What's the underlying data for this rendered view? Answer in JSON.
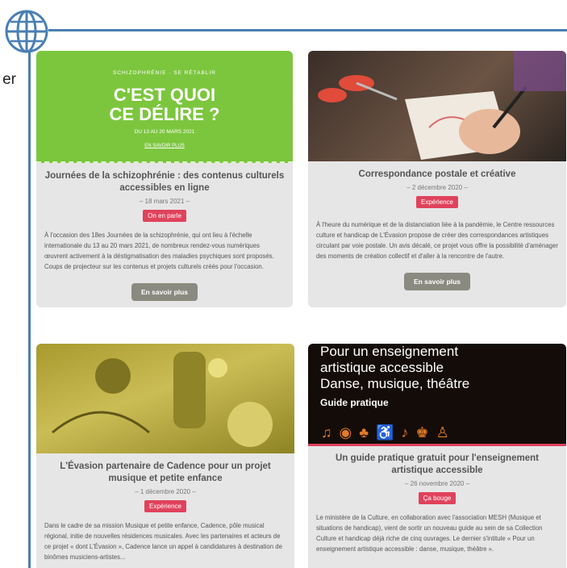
{
  "left_edge_text": "er",
  "cards": [
    {
      "hero": {
        "kicker": "SCHIZOPHRÉNIE · SE RÉTABLIR",
        "big_line1": "C'EST QUOI",
        "big_line2": "CE DÉLIRE ?",
        "dates": "DU 13 AU 20 MARS 2021",
        "link": "EN SAVOIR PLUS"
      },
      "title": "Journées de la schizophrénie : des contenus culturels accessibles en ligne",
      "date": "– 18 mars 2021 –",
      "badge": "On en parle",
      "body": "À l'occasion des 18es Journées de la schizophrénie, qui ont lieu à l'échelle internationale du 13 au 20 mars 2021, de nombreux rendez-vous numériques œuvrent activement à la déstigmatisation des maladies psychiques sont proposés. Coups de projecteur sur les contenus et projets culturels créés pour l'occasion.",
      "button": "En savoir plus"
    },
    {
      "title": "Correspondance postale et créative",
      "date": "– 2 décembre 2020 –",
      "badge": "Expérience",
      "body": "À l'heure du numérique et de la distanciation liée à la pandémie, le Centre ressources culture et handicap de L'Évasion propose de créer des correspondances artistiques circulant par voie postale. Un avis décalé, ce projet vous offre la possibilité d'aménager des moments de création collectif et d'aller à la rencontre de l'autre.",
      "button": "En savoir plus"
    },
    {
      "title": "L'Évasion partenaire de Cadence pour un projet musique et petite enfance",
      "date": "– 1 décembre 2020 –",
      "badge": "Expérience",
      "body": "Dans le cadre de sa mission Musique et petite enfance, Cadence, pôle musical régional, initie de nouvelles résidences musicales. Avec les partenaires et acteurs de ce projet « dont L'Évasion », Cadence lance un appel à candidatures à destination de binômes musiciens-artistes..."
    },
    {
      "hero": {
        "line1": "Pour un enseignement",
        "line2": "artistique accessible",
        "line3": "Danse, musique, théâtre",
        "subtitle": "Guide pratique",
        "icons": "♫◉♣♿♪♚♙"
      },
      "title": "Un guide pratique gratuit pour l'enseignement artistique accessible",
      "date": "– 26 novembre 2020 –",
      "badge": "Ça bouge",
      "body": "Le ministère de la Culture, en collaboration avec l'association MESH (Musique et situations de handicap), vient de sortir un nouveau guide au sein de sa Collection Culture et handicap déjà riche de cinq ouvrages. Le dernier s'intitule « Pour un enseignement artistique accessible : danse, musique, théâtre »."
    }
  ],
  "colors": {
    "accent_blue": "#4a7fb3",
    "badge": "#e0425c",
    "hero_green": "#7cc63e",
    "card_bg": "#e6e6e6"
  }
}
